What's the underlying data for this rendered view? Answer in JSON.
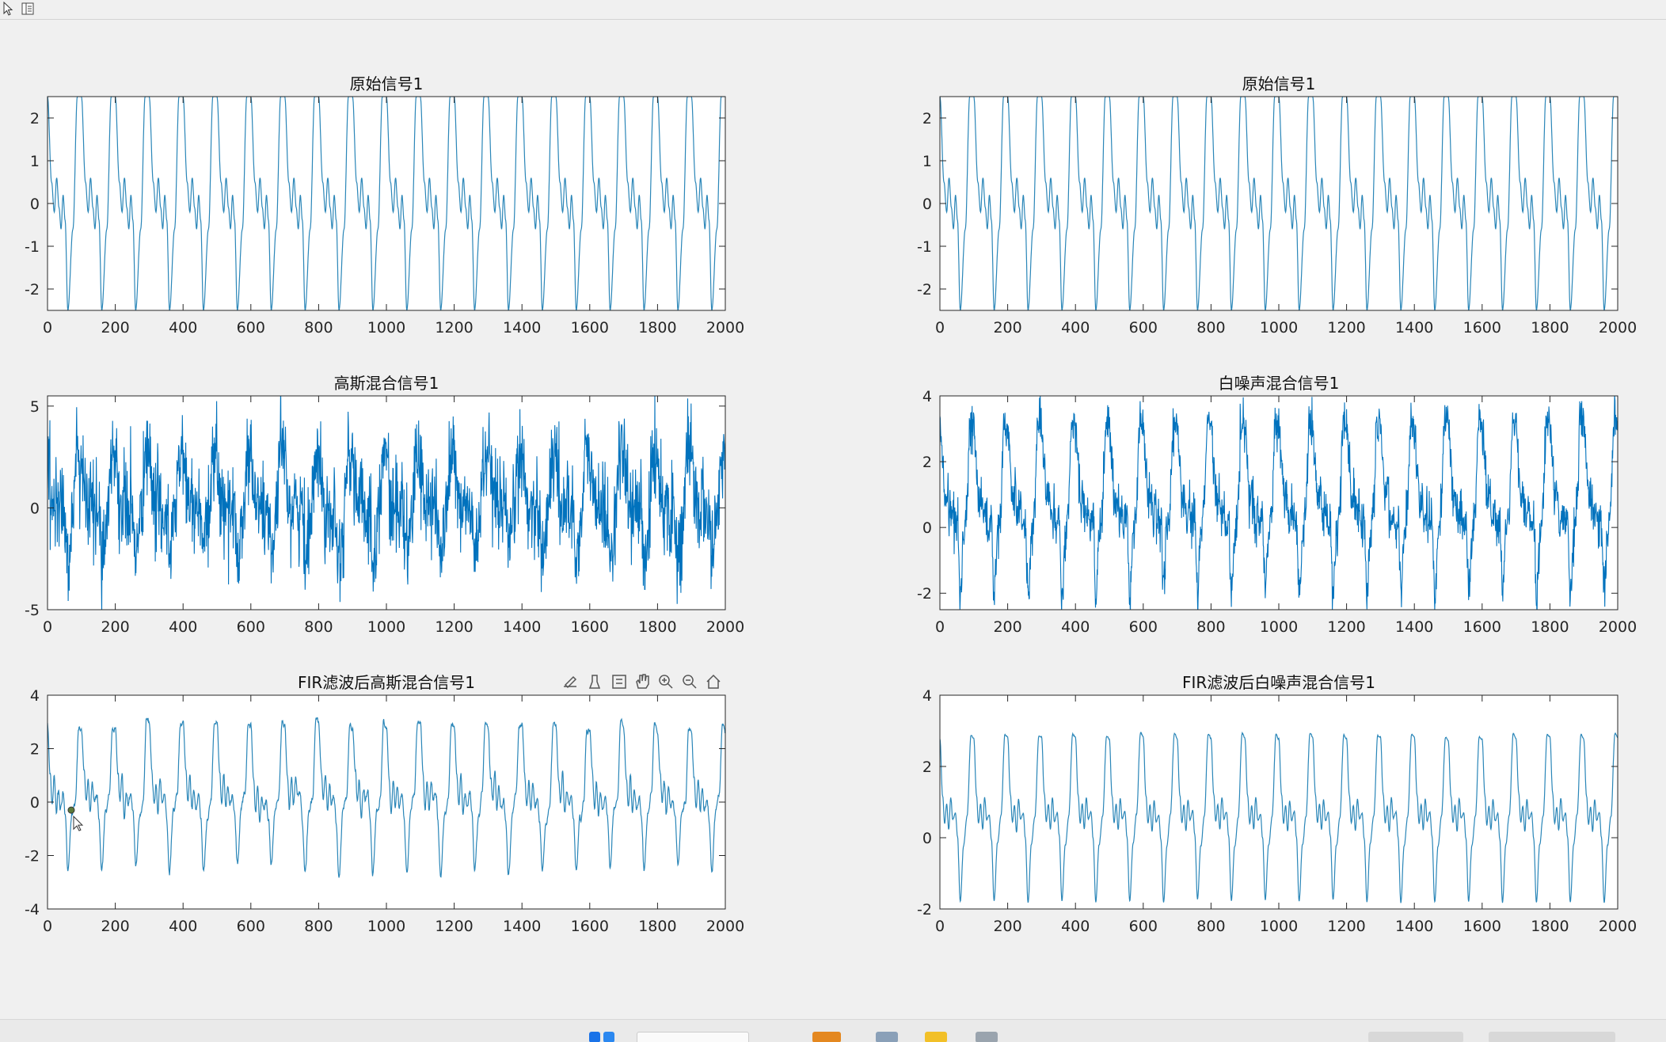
{
  "toolbar": {
    "icons": [
      "pointer-arrow-icon",
      "property-inspector-icon"
    ]
  },
  "axes_toolbar": {
    "icons": [
      "data-cursor-icon",
      "brush-icon",
      "data-tips-icon",
      "pan-hand-icon",
      "zoom-in-icon",
      "zoom-out-icon",
      "restore-view-home-icon"
    ]
  },
  "colors": {
    "line_thin": "#2a86b8",
    "line_noisy": "#0072bd",
    "figure_bg": "#f0f0f0",
    "axes_bg": "#ffffff"
  },
  "chart_data": [
    {
      "id": "p1",
      "type": "line",
      "title": "原始信号1",
      "xlabel": "",
      "ylabel": "",
      "xlim": [
        0,
        2000
      ],
      "ylim": [
        -2.5,
        2.5
      ],
      "xticks": [
        0,
        200,
        400,
        600,
        800,
        1000,
        1200,
        1400,
        1600,
        1800,
        2000
      ],
      "yticks": [
        -2,
        -1,
        0,
        1,
        2
      ],
      "period": 100,
      "cycle": [
        [
          0,
          2.5
        ],
        [
          12,
          0.5
        ],
        [
          20,
          -0.2
        ],
        [
          27,
          0.6
        ],
        [
          34,
          -0.1
        ],
        [
          40,
          -0.6
        ],
        [
          46,
          0.2
        ],
        [
          52,
          -0.4
        ],
        [
          60,
          -2.5
        ],
        [
          75,
          -0.6
        ],
        [
          88,
          2.5
        ],
        [
          100,
          2.5
        ]
      ],
      "noise": 0,
      "thin": true
    },
    {
      "id": "p2",
      "type": "line",
      "title": "原始信号1",
      "xlabel": "",
      "ylabel": "",
      "xlim": [
        0,
        2000
      ],
      "ylim": [
        -2.5,
        2.5
      ],
      "xticks": [
        0,
        200,
        400,
        600,
        800,
        1000,
        1200,
        1400,
        1600,
        1800,
        2000
      ],
      "yticks": [
        -2,
        -1,
        0,
        1,
        2
      ],
      "period": 100,
      "cycle": [
        [
          0,
          2.5
        ],
        [
          12,
          0.5
        ],
        [
          20,
          -0.2
        ],
        [
          27,
          0.6
        ],
        [
          34,
          -0.1
        ],
        [
          40,
          -0.6
        ],
        [
          46,
          0.2
        ],
        [
          52,
          -0.4
        ],
        [
          60,
          -2.5
        ],
        [
          75,
          -0.6
        ],
        [
          88,
          2.5
        ],
        [
          100,
          2.5
        ]
      ],
      "noise": 0,
      "thin": true
    },
    {
      "id": "p3",
      "type": "line",
      "title": "高斯混合信号1",
      "xlabel": "",
      "ylabel": "",
      "xlim": [
        0,
        2000
      ],
      "ylim": [
        -5,
        5.5
      ],
      "xticks": [
        0,
        200,
        400,
        600,
        800,
        1000,
        1200,
        1400,
        1600,
        1800,
        2000
      ],
      "yticks": [
        -5,
        0,
        5
      ],
      "period": 100,
      "cycle": [
        [
          0,
          2.5
        ],
        [
          12,
          0.5
        ],
        [
          20,
          -0.2
        ],
        [
          27,
          0.6
        ],
        [
          34,
          -0.1
        ],
        [
          40,
          -0.6
        ],
        [
          46,
          0.2
        ],
        [
          52,
          -0.4
        ],
        [
          60,
          -2.5
        ],
        [
          75,
          -0.6
        ],
        [
          88,
          2.5
        ],
        [
          100,
          2.5
        ]
      ],
      "noise": 1.1,
      "thin": false
    },
    {
      "id": "p4",
      "type": "line",
      "title": "白噪声混合信号1",
      "xlabel": "",
      "ylabel": "",
      "xlim": [
        0,
        2000
      ],
      "ylim": [
        -2.5,
        4
      ],
      "xticks": [
        0,
        200,
        400,
        600,
        800,
        1000,
        1200,
        1400,
        1600,
        1800,
        2000
      ],
      "yticks": [
        -2,
        0,
        2,
        4
      ],
      "period": 100,
      "cycle": [
        [
          0,
          3.1
        ],
        [
          8,
          2.0
        ],
        [
          14,
          0.8
        ],
        [
          22,
          1.0
        ],
        [
          30,
          0.2
        ],
        [
          36,
          0.6
        ],
        [
          44,
          0.0
        ],
        [
          52,
          0.3
        ],
        [
          60,
          -2.1
        ],
        [
          70,
          -0.3
        ],
        [
          78,
          0.5
        ],
        [
          90,
          3.2
        ],
        [
          100,
          3.1
        ]
      ],
      "noise": 0.35,
      "thin": false
    },
    {
      "id": "p5",
      "type": "line",
      "title": "FIR滤波后高斯混合信号1",
      "xlabel": "",
      "ylabel": "",
      "xlim": [
        0,
        2000
      ],
      "ylim": [
        -4,
        4
      ],
      "xticks": [
        0,
        200,
        400,
        600,
        800,
        1000,
        1200,
        1400,
        1600,
        1800,
        2000
      ],
      "yticks": [
        -4,
        -2,
        0,
        2,
        4
      ],
      "period": 100,
      "cycle": [
        [
          0,
          2.8
        ],
        [
          8,
          1.0
        ],
        [
          14,
          -0.1
        ],
        [
          20,
          0.9
        ],
        [
          26,
          -0.4
        ],
        [
          32,
          0.5
        ],
        [
          38,
          -0.2
        ],
        [
          46,
          0.2
        ],
        [
          52,
          -0.6
        ],
        [
          60,
          -2.6
        ],
        [
          72,
          -0.4
        ],
        [
          82,
          0.2
        ],
        [
          92,
          2.9
        ],
        [
          100,
          2.8
        ]
      ],
      "noise": 0.25,
      "smooth": true,
      "thin": true,
      "data_tip": {
        "x": 70,
        "y": -0.3
      }
    },
    {
      "id": "p6",
      "type": "line",
      "title": "FIR滤波后白噪声混合信号1",
      "xlabel": "",
      "ylabel": "",
      "xlim": [
        0,
        2000
      ],
      "ylim": [
        -2,
        4
      ],
      "xticks": [
        0,
        200,
        400,
        600,
        800,
        1000,
        1200,
        1400,
        1600,
        1800,
        2000
      ],
      "yticks": [
        -2,
        0,
        2,
        4
      ],
      "period": 100,
      "cycle": [
        [
          0,
          2.8
        ],
        [
          8,
          1.2
        ],
        [
          14,
          0.4
        ],
        [
          20,
          0.9
        ],
        [
          26,
          0.2
        ],
        [
          32,
          1.1
        ],
        [
          38,
          0.5
        ],
        [
          46,
          0.7
        ],
        [
          52,
          0.0
        ],
        [
          60,
          -1.8
        ],
        [
          70,
          -0.2
        ],
        [
          80,
          0.6
        ],
        [
          92,
          2.9
        ],
        [
          100,
          2.8
        ]
      ],
      "noise": 0.05,
      "smooth": true,
      "thin": true
    }
  ]
}
